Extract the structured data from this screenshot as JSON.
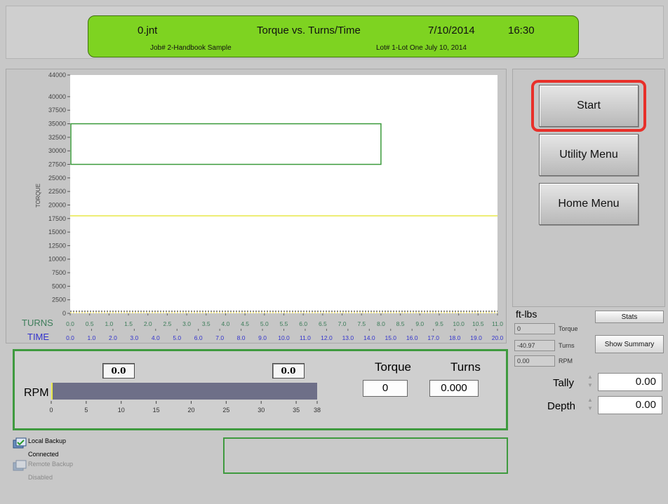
{
  "header": {
    "filename": "0.jnt",
    "title": "Torque vs. Turns/Time",
    "date": "7/10/2014",
    "time": "16:30",
    "job": "Job# 2-Handbook Sample",
    "lot": "Lot# 1-Lot One July 10, 2014"
  },
  "colors": {
    "banner": "#7ed321",
    "panel_border": "#3f9a3f",
    "highlight": "#e8302a",
    "turns_axis": "#3d7d5a",
    "time_axis": "#3333cc"
  },
  "chart": {
    "ylabel": "TORQUE",
    "turns_label": "TURNS",
    "time_label": "TIME",
    "y_ticks": [
      "0",
      "2500",
      "5000",
      "7500",
      "10000",
      "12500",
      "15000",
      "17500",
      "20000",
      "22500",
      "25000",
      "27500",
      "30000",
      "32500",
      "35000",
      "37500",
      "40000",
      "44000"
    ],
    "turns_ticks": [
      "0.0",
      "0.5",
      "1.0",
      "1.5",
      "2.0",
      "2.5",
      "3.0",
      "3.5",
      "4.0",
      "4.5",
      "5.0",
      "5.5",
      "6.0",
      "6.5",
      "7.0",
      "7.5",
      "8.0",
      "8.5",
      "9.0",
      "9.5",
      "10.0",
      "10.5",
      "11.0"
    ],
    "time_ticks": [
      "0.0",
      "1.0",
      "2.0",
      "3.0",
      "4.0",
      "5.0",
      "6.0",
      "7.0",
      "8.0",
      "9.0",
      "10.0",
      "11.0",
      "12.0",
      "13.0",
      "14.0",
      "15.0",
      "16.0",
      "17.0",
      "18.0",
      "19.0",
      "20.0"
    ]
  },
  "chart_data": {
    "type": "line",
    "ylabel": "TORQUE",
    "xlabel": "TURNS",
    "ylim": [
      0,
      44000
    ],
    "xlim": [
      0,
      11.0
    ],
    "time_xlim": [
      0,
      20.0
    ],
    "acceptance_window": {
      "turns": [
        0,
        8.0
      ],
      "torque": [
        27500,
        35000
      ],
      "color": "#3a9a3a"
    },
    "reference_line": {
      "torque": 18000,
      "color": "#e8e84a"
    },
    "baseline": {
      "torque": 0,
      "color": "#555555"
    }
  },
  "buttons": {
    "start": "Start",
    "utility_menu": "Utility Menu",
    "home_menu": "Home Menu",
    "stats": "Stats",
    "show_summary": "Show Summary"
  },
  "stats": {
    "units": "ft-lbs",
    "torque_value": "0",
    "torque_label": "Torque",
    "turns_value": "-40.97",
    "turns_label": "Turns",
    "rpm_value": "0.00",
    "rpm_label": "RPM"
  },
  "tally": {
    "label": "Tally",
    "value": "0.00"
  },
  "depth": {
    "label": "Depth",
    "value": "0.00"
  },
  "rpm": {
    "label": "RPM",
    "left_value": "0.0",
    "right_value": "0.0",
    "max": 38,
    "current": 0,
    "ticks": [
      "0",
      "5",
      "10",
      "15",
      "20",
      "25",
      "30",
      "35",
      "38"
    ]
  },
  "readout": {
    "torque_label": "Torque",
    "torque_value": "0",
    "turns_label": "Turns",
    "turns_value": "0.000"
  },
  "backup": {
    "local_label": "Local Backup",
    "local_status": "Connected",
    "remote_label": "Remote Backup",
    "remote_status": "Disabled"
  }
}
